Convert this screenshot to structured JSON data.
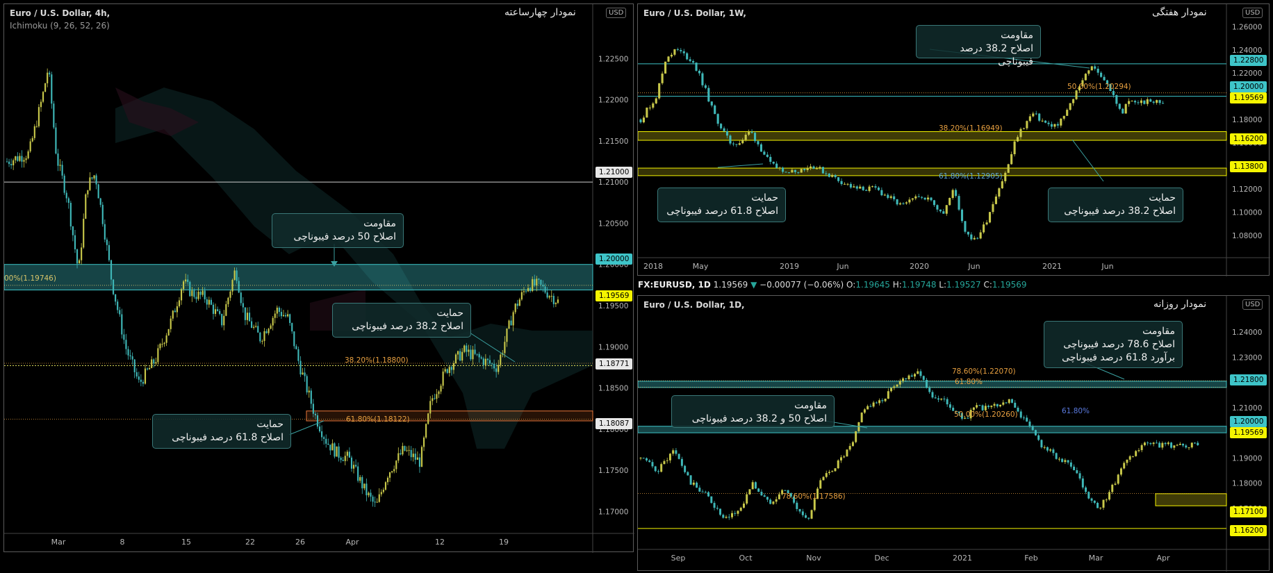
{
  "ticker": {
    "symbol": "FX:EURUSD, 1D",
    "last": "1.19569",
    "arrow": "▼",
    "change": "−0.00077 (−0.06%)",
    "o_label": "O:",
    "o": "1.19645",
    "h_label": "H:",
    "h": "1.19748",
    "l_label": "L:",
    "l": "1.19527",
    "c_label": "C:",
    "c": "1.19569"
  },
  "chart_data": [
    {
      "type": "candlestick",
      "title": "Euro / U.S. Dollar, 4h,",
      "indicator": "Ichimoku (9, 26, 52, 26)",
      "panel_title": "نمودار چهارساعته",
      "currency": "USD",
      "x_ticks": [
        "Mar",
        "8",
        "15",
        "22",
        "26",
        "Apr",
        "12",
        "19"
      ],
      "y_ticks": [
        "1.22500",
        "1.22000",
        "1.21500",
        "1.21000",
        "1.20500",
        "1.20000",
        "1.19500",
        "1.19000",
        "1.18500",
        "1.18000",
        "1.17500",
        "1.17000"
      ],
      "ylim": [
        1.1675,
        1.2295
      ],
      "price_labels": [
        {
          "text": "1.21000",
          "kind": "white"
        },
        {
          "text": "1.20000",
          "kind": "teal"
        },
        {
          "text": "1.19569",
          "kind": "yellow"
        },
        {
          "text": "1.18771",
          "kind": "white"
        },
        {
          "text": "1.18087",
          "kind": "white"
        }
      ],
      "fib_labels": [
        "00%(1.19746)",
        "38.20%(1.18800)",
        "61.80%(1.18122)"
      ],
      "annotations": [
        {
          "title": "مقاومت",
          "text": "اصلاح 50 درصد فیبوناچی"
        },
        {
          "title": "حمایت",
          "text": "اصلاح 38.2 درصد فیبوناچی"
        },
        {
          "title": "حمایت",
          "text": "اصلاح 61.8 درصد فیبوناچی"
        }
      ],
      "price_path": [
        [
          0,
          1.2125
        ],
        [
          0.04,
          1.2135
        ],
        [
          0.065,
          1.2205
        ],
        [
          0.075,
          1.224
        ],
        [
          0.09,
          1.213
        ],
        [
          0.11,
          1.208
        ],
        [
          0.13,
          1.199
        ],
        [
          0.145,
          1.2095
        ],
        [
          0.16,
          1.211
        ],
        [
          0.175,
          1.205
        ],
        [
          0.19,
          1.198
        ],
        [
          0.215,
          1.19
        ],
        [
          0.24,
          1.1855
        ],
        [
          0.27,
          1.1885
        ],
        [
          0.3,
          1.1935
        ],
        [
          0.32,
          1.198
        ],
        [
          0.335,
          1.1965
        ],
        [
          0.36,
          1.196
        ],
        [
          0.39,
          1.193
        ],
        [
          0.415,
          1.1995
        ],
        [
          0.43,
          1.194
        ],
        [
          0.46,
          1.191
        ],
        [
          0.49,
          1.1945
        ],
        [
          0.51,
          1.1935
        ],
        [
          0.53,
          1.188
        ],
        [
          0.56,
          1.1815
        ],
        [
          0.58,
          1.1785
        ],
        [
          0.6,
          1.177
        ],
        [
          0.62,
          1.1765
        ],
        [
          0.65,
          1.1725
        ],
        [
          0.67,
          1.1705
        ],
        [
          0.69,
          1.1745
        ],
        [
          0.72,
          1.1775
        ],
        [
          0.75,
          1.176
        ],
        [
          0.77,
          1.1835
        ],
        [
          0.8,
          1.1875
        ],
        [
          0.83,
          1.1895
        ],
        [
          0.86,
          1.1885
        ],
        [
          0.89,
          1.1875
        ],
        [
          0.92,
          1.1945
        ],
        [
          0.945,
          1.1975
        ],
        [
          0.965,
          1.1975
        ],
        [
          1,
          1.1955
        ]
      ]
    },
    {
      "type": "candlestick",
      "title": "Euro / U.S. Dollar, 1W,",
      "panel_title": "نمودار هفتگی",
      "currency": "USD",
      "x_ticks": [
        "2018",
        "May",
        "2019",
        "Jun",
        "2020",
        "Jun",
        "2021",
        "Jun"
      ],
      "y_ticks": [
        "1.26000",
        "1.24000",
        "1.22000",
        "1.20000",
        "1.18000",
        "1.16000",
        "1.14000",
        "1.12000",
        "1.10000",
        "1.08000"
      ],
      "ylim": [
        1.0625,
        1.2645
      ],
      "price_labels": [
        {
          "text": "1.22800",
          "kind": "teal"
        },
        {
          "text": "1.20000",
          "kind": "teal"
        },
        {
          "text": "1.19569",
          "kind": "yellow"
        },
        {
          "text": "1.16200",
          "kind": "yellow"
        },
        {
          "text": "1.13800",
          "kind": "yellow"
        }
      ],
      "fib_labels": [
        "50.00%(1.20294)",
        "38.20%(1.16949)",
        "61.80%(1.12905)"
      ],
      "annotations": [
        {
          "title": "مقاومت",
          "text": "اصلاح 38.2 درصد فیبوناچی"
        },
        {
          "title": "حمایت",
          "text": "اصلاح 61.8 درصد فیبوناچی"
        },
        {
          "title": "حمایت",
          "text": "اصلاح 38.2 درصد فیبوناچی"
        }
      ],
      "price_path": [
        [
          0,
          1.18
        ],
        [
          0.03,
          1.2
        ],
        [
          0.05,
          1.235
        ],
        [
          0.07,
          1.24
        ],
        [
          0.1,
          1.23
        ],
        [
          0.12,
          1.21
        ],
        [
          0.14,
          1.185
        ],
        [
          0.17,
          1.16
        ],
        [
          0.19,
          1.16
        ],
        [
          0.21,
          1.17
        ],
        [
          0.25,
          1.14
        ],
        [
          0.29,
          1.135
        ],
        [
          0.33,
          1.14
        ],
        [
          0.37,
          1.13
        ],
        [
          0.41,
          1.12
        ],
        [
          0.45,
          1.12
        ],
        [
          0.5,
          1.105
        ],
        [
          0.54,
          1.115
        ],
        [
          0.58,
          1.1
        ],
        [
          0.6,
          1.12
        ],
        [
          0.62,
          1.085
        ],
        [
          0.64,
          1.075
        ],
        [
          0.66,
          1.09
        ],
        [
          0.68,
          1.115
        ],
        [
          0.7,
          1.135
        ],
        [
          0.72,
          1.165
        ],
        [
          0.75,
          1.185
        ],
        [
          0.78,
          1.175
        ],
        [
          0.8,
          1.175
        ],
        [
          0.82,
          1.19
        ],
        [
          0.84,
          1.21
        ],
        [
          0.86,
          1.225
        ],
        [
          0.88,
          1.22
        ],
        [
          0.9,
          1.205
        ],
        [
          0.92,
          1.185
        ],
        [
          0.935,
          1.195
        ]
      ]
    },
    {
      "type": "candlestick",
      "title": "Euro / U.S. Dollar, 1D,",
      "panel_title": "نمودار روزانه",
      "currency": "USD",
      "x_ticks": [
        "Sep",
        "Oct",
        "Nov",
        "Dec",
        "2021",
        "Feb",
        "Mar",
        "Apr"
      ],
      "y_ticks": [
        "1.24000",
        "1.23000",
        "1.22000",
        "1.21000",
        "1.20000",
        "1.19000",
        "1.18000",
        "1.17000",
        "1.16000"
      ],
      "ylim": [
        1.1545,
        1.2475
      ],
      "price_labels": [
        {
          "text": "1.21800",
          "kind": "teal"
        },
        {
          "text": "1.20000",
          "kind": "teal"
        },
        {
          "text": "1.19569",
          "kind": "yellow"
        },
        {
          "text": "1.17100",
          "kind": "yellow"
        },
        {
          "text": "1.16200",
          "kind": "yellow"
        }
      ],
      "fib_labels": [
        "78.60%(1.22070)",
        "61.80%",
        "50.00%(1.20260)",
        "61.80%",
        "78.60%(1.17586)"
      ],
      "annotations": [
        {
          "title": "مقاومت",
          "text": "اصلاح 50 و 38.2 درصد فیبوناچی"
        },
        {
          "title": "مقاومت",
          "text": "اصلاح 78.6 درصد فیبوناچی",
          "text2": "برآورد 61.8 درصد فیبوناچی"
        }
      ],
      "price_path": [
        [
          0,
          1.19
        ],
        [
          0.03,
          1.185
        ],
        [
          0.06,
          1.193
        ],
        [
          0.09,
          1.18
        ],
        [
          0.12,
          1.175
        ],
        [
          0.15,
          1.165
        ],
        [
          0.18,
          1.17
        ],
        [
          0.2,
          1.18
        ],
        [
          0.23,
          1.172
        ],
        [
          0.26,
          1.178
        ],
        [
          0.28,
          1.17
        ],
        [
          0.3,
          1.165
        ],
        [
          0.32,
          1.18
        ],
        [
          0.35,
          1.187
        ],
        [
          0.38,
          1.195
        ],
        [
          0.4,
          1.21
        ],
        [
          0.43,
          1.212
        ],
        [
          0.46,
          1.22
        ],
        [
          0.5,
          1.225
        ],
        [
          0.52,
          1.215
        ],
        [
          0.55,
          1.212
        ],
        [
          0.58,
          1.205
        ],
        [
          0.6,
          1.21
        ],
        [
          0.63,
          1.21
        ],
        [
          0.66,
          1.213
        ],
        [
          0.69,
          1.205
        ],
        [
          0.72,
          1.195
        ],
        [
          0.75,
          1.19
        ],
        [
          0.78,
          1.185
        ],
        [
          0.8,
          1.175
        ],
        [
          0.82,
          1.17
        ],
        [
          0.84,
          1.175
        ],
        [
          0.86,
          1.185
        ],
        [
          0.88,
          1.19
        ],
        [
          0.9,
          1.195
        ]
      ]
    }
  ]
}
